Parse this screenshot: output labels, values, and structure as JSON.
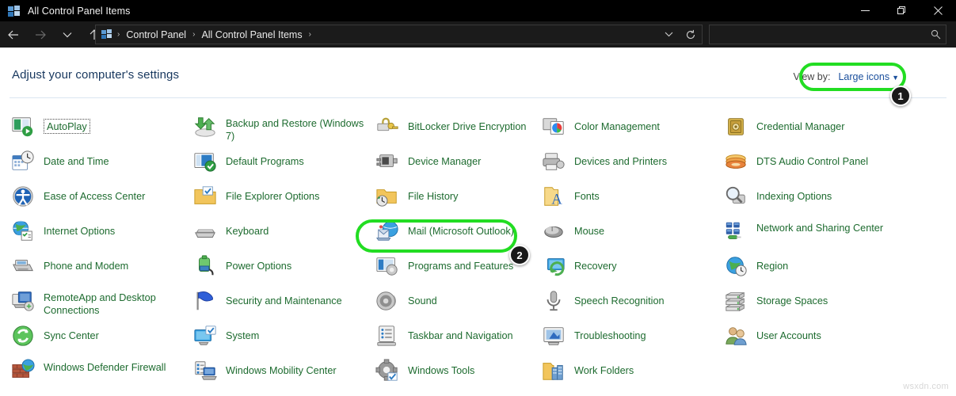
{
  "window": {
    "title": "All Control Panel Items",
    "icon": "control-panel-icon",
    "controls": {
      "minimize": "minimize-icon",
      "restore": "restore-icon",
      "close": "close-icon"
    }
  },
  "nav": {
    "back": "back-arrow-icon",
    "forward": "forward-arrow-icon",
    "recent": "chevron-down-icon",
    "up": "up-arrow-icon",
    "breadcrumbs": [
      "Control Panel",
      "All Control Panel Items"
    ],
    "separator": "›",
    "history_dropdown": "chevron-down-icon",
    "refresh": "refresh-icon"
  },
  "search": {
    "value": "",
    "placeholder": "",
    "icon": "search-icon"
  },
  "main": {
    "page_title": "Adjust your computer's settings",
    "view_by": {
      "label": "View by:",
      "value": "Large icons",
      "caret": "▼"
    }
  },
  "items": [
    {
      "label": "AutoPlay",
      "icon": "autoplay-icon",
      "focused": true
    },
    {
      "label": "Backup and Restore (Windows 7)",
      "icon": "backup-restore-icon",
      "two_line": true
    },
    {
      "label": "BitLocker Drive Encryption",
      "icon": "bitlocker-icon"
    },
    {
      "label": "Color Management",
      "icon": "color-management-icon"
    },
    {
      "label": "Credential Manager",
      "icon": "credential-manager-icon"
    },
    {
      "label": "Date and Time",
      "icon": "date-time-icon"
    },
    {
      "label": "Default Programs",
      "icon": "default-programs-icon"
    },
    {
      "label": "Device Manager",
      "icon": "device-manager-icon"
    },
    {
      "label": "Devices and Printers",
      "icon": "devices-printers-icon"
    },
    {
      "label": "DTS Audio Control Panel",
      "icon": "dts-audio-icon"
    },
    {
      "label": "Ease of Access Center",
      "icon": "ease-of-access-icon"
    },
    {
      "label": "File Explorer Options",
      "icon": "file-explorer-options-icon"
    },
    {
      "label": "File History",
      "icon": "file-history-icon"
    },
    {
      "label": "Fonts",
      "icon": "fonts-icon"
    },
    {
      "label": "Indexing Options",
      "icon": "indexing-options-icon"
    },
    {
      "label": "Internet Options",
      "icon": "internet-options-icon"
    },
    {
      "label": "Keyboard",
      "icon": "keyboard-icon"
    },
    {
      "label": "Mail (Microsoft Outlook)",
      "icon": "mail-outlook-icon",
      "highlighted": true
    },
    {
      "label": "Mouse",
      "icon": "mouse-icon"
    },
    {
      "label": "Network and Sharing Center",
      "icon": "network-sharing-icon",
      "two_line": true
    },
    {
      "label": "Phone and Modem",
      "icon": "phone-modem-icon"
    },
    {
      "label": "Power Options",
      "icon": "power-options-icon"
    },
    {
      "label": "Programs and Features",
      "icon": "programs-features-icon"
    },
    {
      "label": "Recovery",
      "icon": "recovery-icon"
    },
    {
      "label": "Region",
      "icon": "region-icon"
    },
    {
      "label": "RemoteApp and Desktop Connections",
      "icon": "remoteapp-icon",
      "two_line": true
    },
    {
      "label": "Security and Maintenance",
      "icon": "security-maintenance-icon"
    },
    {
      "label": "Sound",
      "icon": "sound-icon"
    },
    {
      "label": "Speech Recognition",
      "icon": "speech-recognition-icon"
    },
    {
      "label": "Storage Spaces",
      "icon": "storage-spaces-icon"
    },
    {
      "label": "Sync Center",
      "icon": "sync-center-icon"
    },
    {
      "label": "System",
      "icon": "system-icon"
    },
    {
      "label": "Taskbar and Navigation",
      "icon": "taskbar-navigation-icon"
    },
    {
      "label": "Troubleshooting",
      "icon": "troubleshooting-icon"
    },
    {
      "label": "User Accounts",
      "icon": "user-accounts-icon"
    },
    {
      "label": "Windows Defender Firewall",
      "icon": "windows-defender-firewall-icon",
      "two_line": true
    },
    {
      "label": "Windows Mobility Center",
      "icon": "windows-mobility-icon"
    },
    {
      "label": "Windows Tools",
      "icon": "windows-tools-icon"
    },
    {
      "label": "Work Folders",
      "icon": "work-folders-icon"
    },
    {
      "label": "",
      "icon": ""
    }
  ],
  "annotations": {
    "highlight_color": "#22dd22",
    "badges": [
      {
        "number": "1",
        "target": "view-by-control"
      },
      {
        "number": "2",
        "target": "mail-outlook-item"
      }
    ]
  },
  "watermark": "wsxdn.com"
}
